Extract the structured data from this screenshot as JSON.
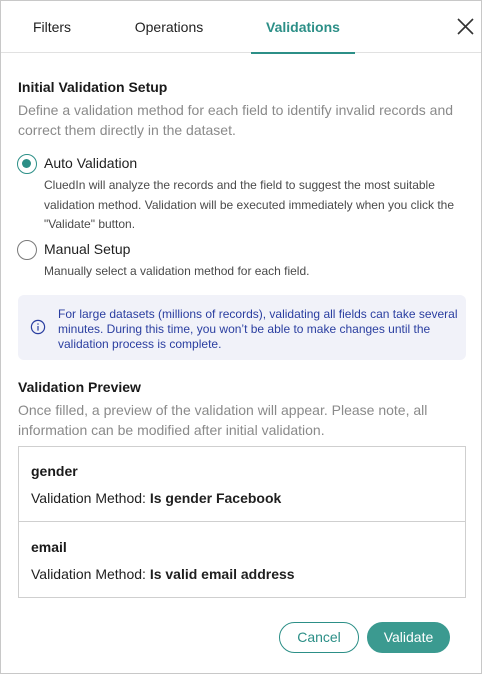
{
  "tabs": {
    "filters": "Filters",
    "operations": "Operations",
    "validations": "Validations",
    "active_color": "#2c8f87"
  },
  "initial": {
    "heading": "Initial Validation Setup",
    "description": "Define a validation method for each field to identify invalid records and correct them directly in the dataset.",
    "options": [
      {
        "label": "Auto Validation",
        "help": "CluedIn will analyze the records and the field to suggest the most suitable validation method. Validation will be executed immediately when you click the \"Validate\" button.",
        "selected": true
      },
      {
        "label": "Manual Setup",
        "help": "Manually select a validation method for each field.",
        "selected": false
      }
    ]
  },
  "info": {
    "icon": "info-icon",
    "text": "For large datasets (millions of records), validating all fields can take several minutes. During this time, you won’t be able to make changes until the validation process is complete."
  },
  "preview": {
    "heading": "Validation Preview",
    "description": "Once filled, a preview of the validation will appear. Please note, all information can be modified after initial validation.",
    "method_prefix": "Validation Method:",
    "rows": [
      {
        "field": "gender",
        "method": "Is gender Facebook"
      },
      {
        "field": "email",
        "method": "Is valid email address"
      }
    ]
  },
  "buttons": {
    "cancel": "Cancel",
    "validate": "Validate"
  }
}
